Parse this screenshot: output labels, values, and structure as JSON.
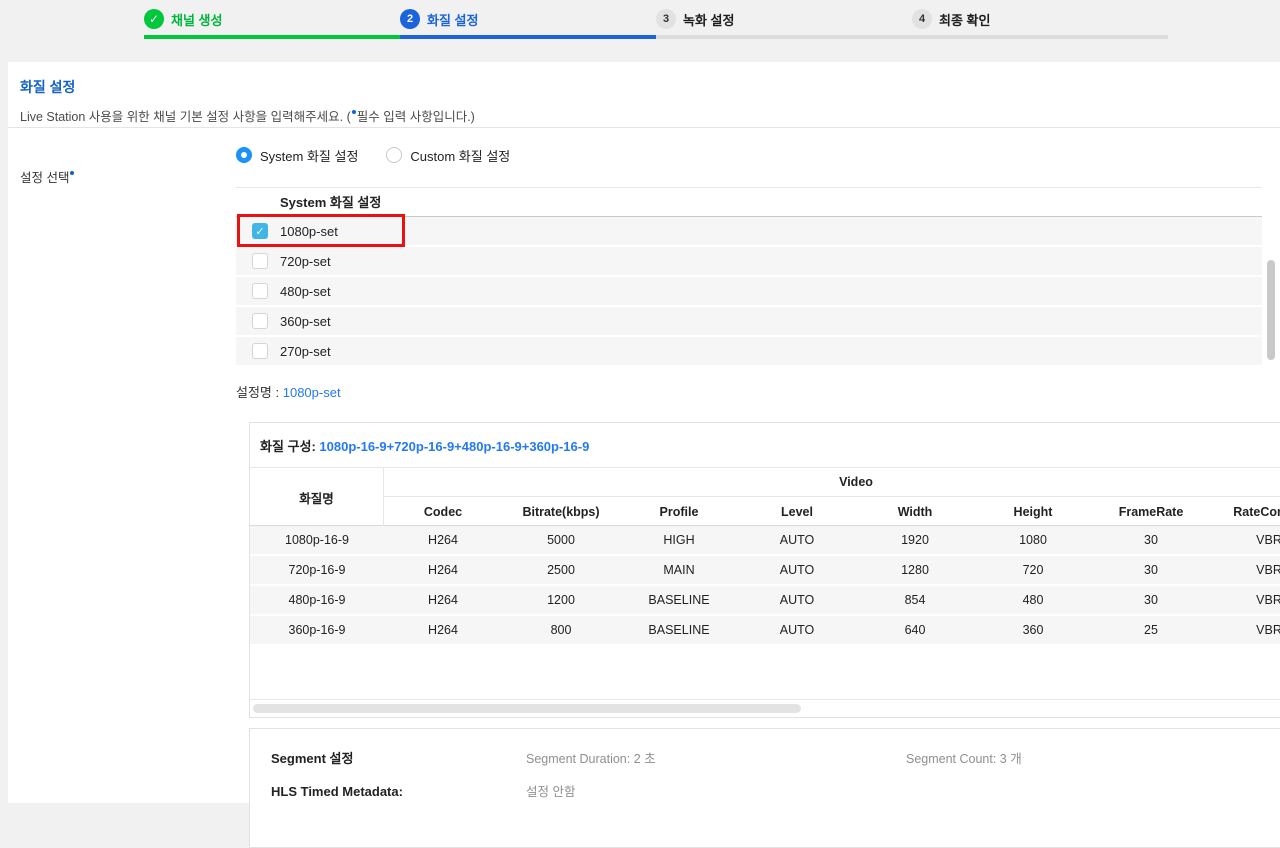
{
  "colors": {
    "step_green": "#00c73c",
    "step_blue": "#1b64da",
    "title_blue": "#1262c7",
    "link_blue": "#2379f4",
    "radio_blue": "#1c90fb",
    "checkbox_blue": "#41b6e6",
    "annotation_red": "#e81212"
  },
  "stepper": {
    "steps": [
      {
        "number": "1",
        "label": "채널 생성",
        "state": "done"
      },
      {
        "number": "2",
        "label": "화질 설정",
        "state": "active"
      },
      {
        "number": "3",
        "label": "녹화 설정",
        "state": "pending"
      },
      {
        "number": "4",
        "label": "최종 확인",
        "state": "pending"
      }
    ],
    "check_glyph": "✓"
  },
  "header": {
    "title": "화질 설정",
    "subtitle_prefix": "Live Station 사용을 위한 채널 기본 설정 사항을 입력해주세요. (",
    "subtitle_suffix": "필수 입력 사항입니다.)"
  },
  "form": {
    "label": "설정 선택",
    "radio_options": [
      {
        "label": "System 화질 설정",
        "selected": true
      },
      {
        "label": "Custom 화질 설정",
        "selected": false
      }
    ]
  },
  "preset_list": {
    "header": "System 화질 설정",
    "check_glyph": "✓",
    "items": [
      {
        "label": "1080p-set",
        "checked": true,
        "highlighted": true
      },
      {
        "label": "720p-set",
        "checked": false,
        "highlighted": false
      },
      {
        "label": "480p-set",
        "checked": false,
        "highlighted": false
      },
      {
        "label": "360p-set",
        "checked": false,
        "highlighted": false
      },
      {
        "label": "270p-set",
        "checked": false,
        "highlighted": false
      }
    ]
  },
  "selected_preset": {
    "label": "설정명 :",
    "value": "1080p-set"
  },
  "quality_detail": {
    "composition_label": "화질 구성:",
    "composition_value": "1080p-16-9+720p-16-9+480p-16-9+360p-16-9",
    "table": {
      "name_header": "화질명",
      "group_header": "Video",
      "columns": [
        "Codec",
        "Bitrate(kbps)",
        "Profile",
        "Level",
        "Width",
        "Height",
        "FrameRate",
        "RateControl"
      ],
      "rows": [
        [
          "1080p-16-9",
          "H264",
          "5000",
          "HIGH",
          "AUTO",
          "1920",
          "1080",
          "30",
          "VBR"
        ],
        [
          "720p-16-9",
          "H264",
          "2500",
          "MAIN",
          "AUTO",
          "1280",
          "720",
          "30",
          "VBR"
        ],
        [
          "480p-16-9",
          "H264",
          "1200",
          "BASELINE",
          "AUTO",
          "854",
          "480",
          "30",
          "VBR"
        ],
        [
          "360p-16-9",
          "H264",
          "800",
          "BASELINE",
          "AUTO",
          "640",
          "360",
          "25",
          "VBR"
        ]
      ]
    }
  },
  "segment_settings": {
    "title": "Segment 설정",
    "duration": "Segment Duration: 2 초",
    "count": "Segment Count: 3 개",
    "hls_label": "HLS Timed Metadata:",
    "hls_value": "설정 안함"
  }
}
